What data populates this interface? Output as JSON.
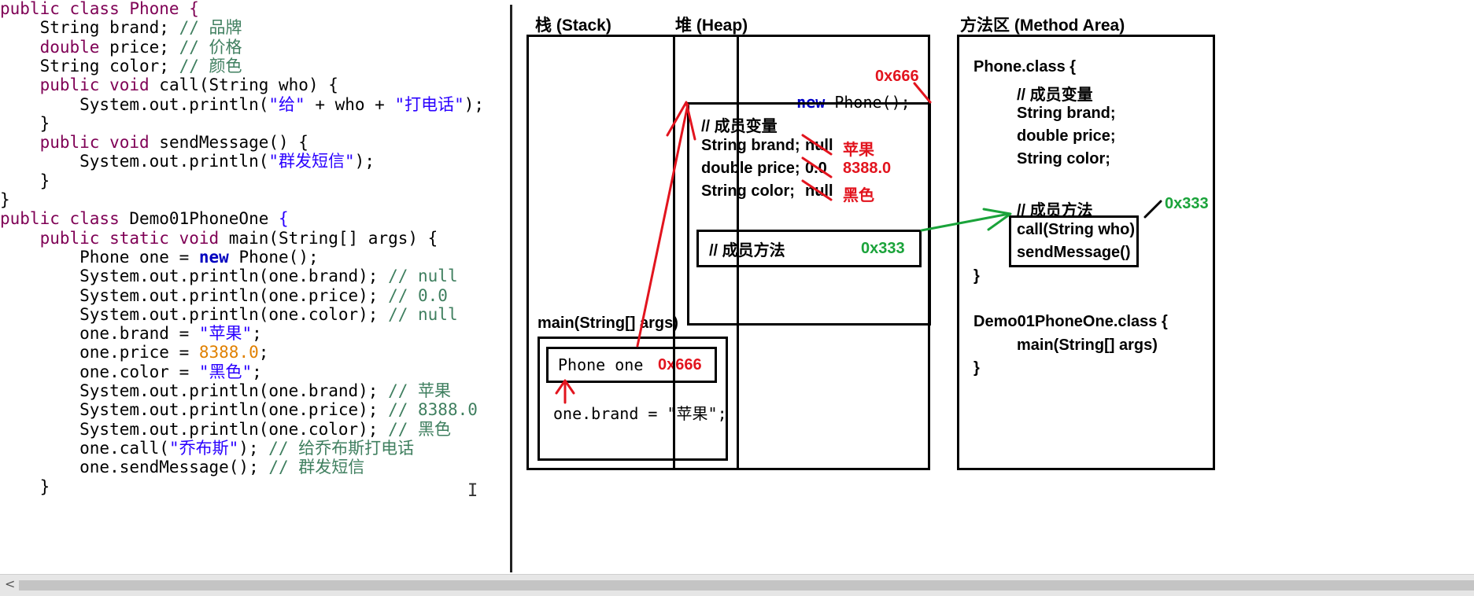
{
  "code": {
    "lines": [
      [
        {
          "t": "public class Phone {",
          "c": "kw"
        }
      ],
      [
        {
          "t": "    String brand; ",
          "c": ""
        },
        {
          "t": "// 品牌",
          "c": "cm"
        }
      ],
      [
        {
          "t": "    double",
          "c": "kw"
        },
        {
          "t": " price; ",
          "c": ""
        },
        {
          "t": "// 价格",
          "c": "cm"
        }
      ],
      [
        {
          "t": "    String color; ",
          "c": ""
        },
        {
          "t": "// 颜色",
          "c": "cm"
        }
      ],
      [
        {
          "t": "    public void",
          "c": "kw"
        },
        {
          "t": " call(String who) {",
          "c": ""
        }
      ],
      [
        {
          "t": "        System.out.println(",
          "c": ""
        },
        {
          "t": "\"给\"",
          "c": "st"
        },
        {
          "t": " + who + ",
          "c": ""
        },
        {
          "t": "\"打电话\"",
          "c": "st"
        },
        {
          "t": ");",
          "c": ""
        }
      ],
      [
        {
          "t": "    }",
          "c": ""
        }
      ],
      [
        {
          "t": "    public void",
          "c": "kw"
        },
        {
          "t": " sendMessage() {",
          "c": ""
        }
      ],
      [
        {
          "t": "        System.out.println(",
          "c": ""
        },
        {
          "t": "\"群发短信\"",
          "c": "st"
        },
        {
          "t": ");",
          "c": ""
        }
      ],
      [
        {
          "t": "    }",
          "c": ""
        }
      ],
      [
        {
          "t": "}",
          "c": ""
        }
      ],
      [
        {
          "t": "public class",
          "c": "kw"
        },
        {
          "t": " Demo01PhoneOne ",
          "c": ""
        },
        {
          "t": "{",
          "c": "st"
        }
      ],
      [
        {
          "t": "    public static void",
          "c": "kw"
        },
        {
          "t": " main(String[] args) {",
          "c": ""
        }
      ],
      [
        {
          "t": "        Phone one = ",
          "c": ""
        },
        {
          "t": "new",
          "c": "kwb"
        },
        {
          "t": " Phone();",
          "c": ""
        }
      ],
      [
        {
          "t": "        System.out.println(one.brand); ",
          "c": ""
        },
        {
          "t": "// null",
          "c": "cm"
        }
      ],
      [
        {
          "t": "        System.out.println(one.price); ",
          "c": ""
        },
        {
          "t": "// 0.0",
          "c": "cm"
        }
      ],
      [
        {
          "t": "        System.out.println(one.color); ",
          "c": ""
        },
        {
          "t": "// null",
          "c": "cm"
        }
      ],
      [
        {
          "t": "        one.brand = ",
          "c": ""
        },
        {
          "t": "\"苹果\"",
          "c": "st"
        },
        {
          "t": ";",
          "c": ""
        }
      ],
      [
        {
          "t": "        one.price = ",
          "c": ""
        },
        {
          "t": "8388.0",
          "c": "nm"
        },
        {
          "t": ";",
          "c": ""
        }
      ],
      [
        {
          "t": "        one.color = ",
          "c": ""
        },
        {
          "t": "\"黑色\"",
          "c": "st"
        },
        {
          "t": ";",
          "c": ""
        }
      ],
      [
        {
          "t": "        System.out.println(one.brand); ",
          "c": ""
        },
        {
          "t": "// 苹果",
          "c": "cm"
        }
      ],
      [
        {
          "t": "        System.out.println(one.price); ",
          "c": ""
        },
        {
          "t": "// 8388.0",
          "c": "cm"
        }
      ],
      [
        {
          "t": "        System.out.println(one.color); ",
          "c": ""
        },
        {
          "t": "// 黑色",
          "c": "cm"
        }
      ],
      [
        {
          "t": "        one.call(",
          "c": ""
        },
        {
          "t": "\"乔布斯\"",
          "c": "st"
        },
        {
          "t": "); ",
          "c": ""
        },
        {
          "t": "// 给乔布斯打电话",
          "c": "cm"
        }
      ],
      [
        {
          "t": "        one.sendMessage(); ",
          "c": ""
        },
        {
          "t": "// 群发短信",
          "c": "cm"
        }
      ],
      [
        {
          "t": "    }",
          "c": ""
        }
      ]
    ],
    "cursor_glyph": "I"
  },
  "stack": {
    "title": "栈  (Stack)",
    "frame_label": "main(String[] args)",
    "var_label": "Phone one",
    "var_value": "0x666",
    "assignment": "one.brand = \"苹果\";"
  },
  "heap": {
    "title": "堆  (Heap)",
    "new_keyword": "new",
    "new_rest": " Phone();",
    "address": "0x666",
    "fields_comment": "// 成员变量",
    "fields": [
      {
        "decl": "String brand;",
        "old": "null",
        "new": "苹果"
      },
      {
        "decl": "double price;",
        "old": "0.0",
        "new": "8388.0"
      },
      {
        "decl": "String color;",
        "old": "null",
        "new": "黑色"
      }
    ],
    "methods_comment": "// 成员方法",
    "methods_address": "0x333"
  },
  "method_area": {
    "title": "方法区  (Method Area)",
    "phone_class": "Phone.class {",
    "fields_comment": "// 成员变量",
    "fields": [
      "String brand;",
      "double price;",
      "String color;"
    ],
    "methods_comment": "// 成员方法",
    "methods_address": "0x333",
    "methods": [
      "call(String who)",
      "sendMessage()"
    ],
    "close1": "}",
    "demo_class": "Demo01PhoneOne.class {",
    "demo_method": "main(String[] args)",
    "close2": "}"
  },
  "colors": {
    "arrow_red": "#e2141e",
    "arrow_green": "#1aa33a",
    "keyword": "#7f0055",
    "comment": "#3f7f5f",
    "string": "#2a00ff",
    "number": "#e08000"
  },
  "scrollbar": {
    "left_arrow": "<"
  }
}
